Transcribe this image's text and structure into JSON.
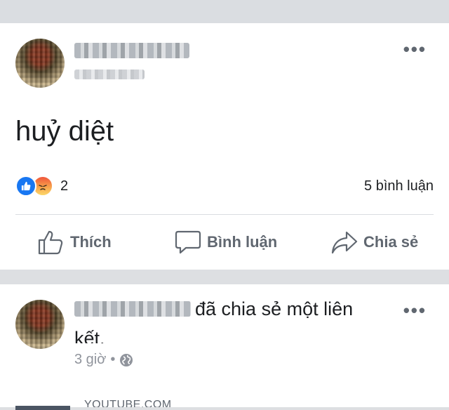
{
  "post1": {
    "author_blurred": "Lê Ngọc Sơn",
    "text": "huỷ diệt",
    "reaction_count": "2",
    "comment_count": "5 bình luận",
    "actions": [
      {
        "label": "Thích",
        "icon": "thumbs-up-icon"
      },
      {
        "label": "Bình luận",
        "icon": "comment-icon"
      },
      {
        "label": "Chia sẻ",
        "icon": "share-icon"
      }
    ]
  },
  "post2": {
    "author_blurred": "Lê Ngọc Sơn",
    "shared_text_line1": "đã chia sẻ một liên",
    "shared_text_line2": "kết.",
    "time": "3 giờ",
    "separator": "•",
    "link_domain": "YOUTUBE.COM"
  },
  "colors": {
    "like_blue": "#1877f2",
    "secondary_text": "#606770",
    "feed_background": "#dddfe2"
  }
}
